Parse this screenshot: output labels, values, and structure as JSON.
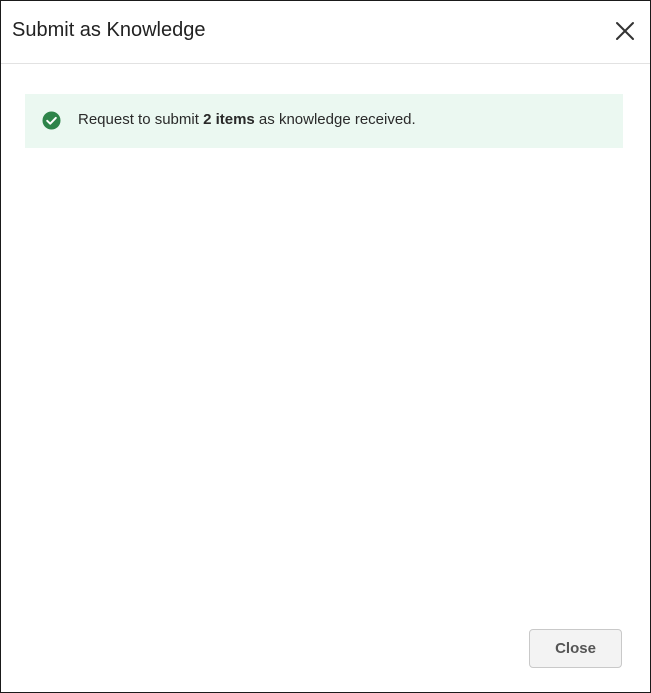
{
  "dialog": {
    "title": "Submit as Knowledge",
    "close_icon": "close-icon"
  },
  "banner": {
    "icon": "check-circle-icon",
    "text_prefix": "Request to submit ",
    "text_bold": "2 items",
    "text_suffix": " as knowledge received.",
    "background_color": "#ebf8f1",
    "icon_color": "#2e844a"
  },
  "footer": {
    "close_label": "Close"
  }
}
